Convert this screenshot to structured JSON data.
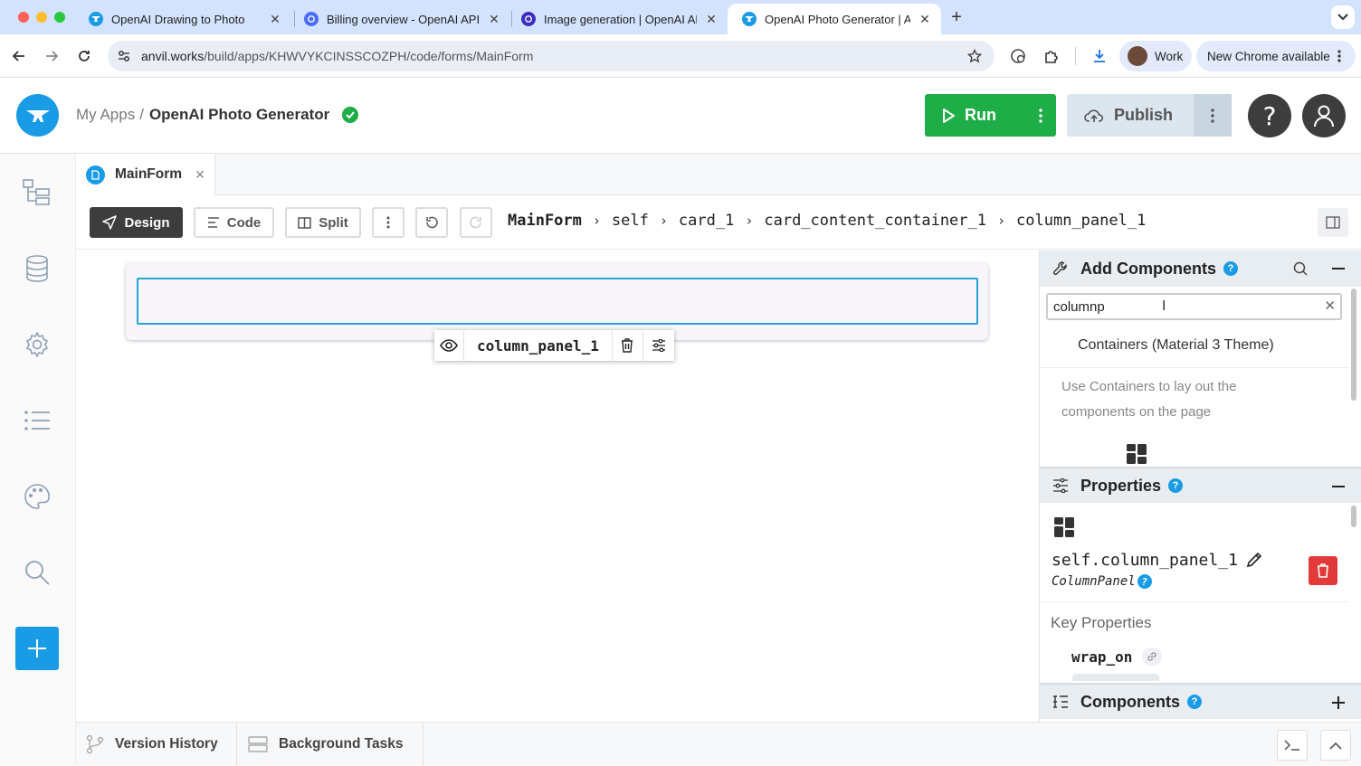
{
  "browser": {
    "tabs": [
      {
        "title": "OpenAI Drawing to Photo",
        "active": false
      },
      {
        "title": "Billing overview - OpenAI API",
        "active": false
      },
      {
        "title": "Image generation | OpenAI API",
        "active": false
      },
      {
        "title": "OpenAI Photo Generator | Anvil",
        "active": true
      }
    ],
    "url_host": "anvil.works",
    "url_path": "/build/apps/KHWVYKCINSSCOZPH/code/forms/MainForm",
    "profile_label": "Work",
    "update_label": "New Chrome available"
  },
  "header": {
    "breadcrumb_root": "My Apps",
    "breadcrumb_sep": "/",
    "app_name": "OpenAI Photo Generator",
    "run_label": "Run",
    "publish_label": "Publish",
    "help_label": "?"
  },
  "editor": {
    "file_tab": "MainForm",
    "mode_buttons": {
      "design": "Design",
      "code": "Code",
      "split": "Split"
    },
    "path": [
      "MainForm",
      "self",
      "card_1",
      "card_content_container_1",
      "column_panel_1"
    ]
  },
  "canvas": {
    "selected_component": "column_panel_1"
  },
  "add_components": {
    "title": "Add Components",
    "search_value": "columnp",
    "category": "Containers (Material 3 Theme)",
    "description": "Use Containers to lay out the components on the page"
  },
  "properties": {
    "title": "Properties",
    "component_name": "self.column_panel_1",
    "component_type": "ColumnPanel",
    "section": "Key Properties",
    "first_property": "wrap_on"
  },
  "components_panel": {
    "title": "Components"
  },
  "bottom": {
    "version_history": "Version History",
    "background_tasks": "Background Tasks"
  },
  "colors": {
    "accent": "#1a9be6",
    "run_green": "#1fad47",
    "publish_bg": "#dce6ef",
    "delete_red": "#e23a3a",
    "tabstrip": "#d3e3fd"
  },
  "icons": [
    "anvil-logo-icon",
    "check-circle-icon",
    "play-icon",
    "cloud-upload-icon",
    "kebab-icon",
    "help-icon",
    "user-icon",
    "tree-icon",
    "database-icon",
    "gear-icon",
    "list-icon",
    "palette-icon",
    "search-icon",
    "plus-icon",
    "design-icon",
    "code-icon",
    "split-icon",
    "undo-icon",
    "redo-icon",
    "panel-toggle-icon",
    "eye-icon",
    "trash-icon",
    "sliders-icon",
    "wrench-icon",
    "minus-icon",
    "close-icon",
    "column-panel-icon",
    "pencil-icon",
    "link-icon",
    "branch-icon",
    "tasks-icon",
    "terminal-icon",
    "chevron-up-icon"
  ]
}
